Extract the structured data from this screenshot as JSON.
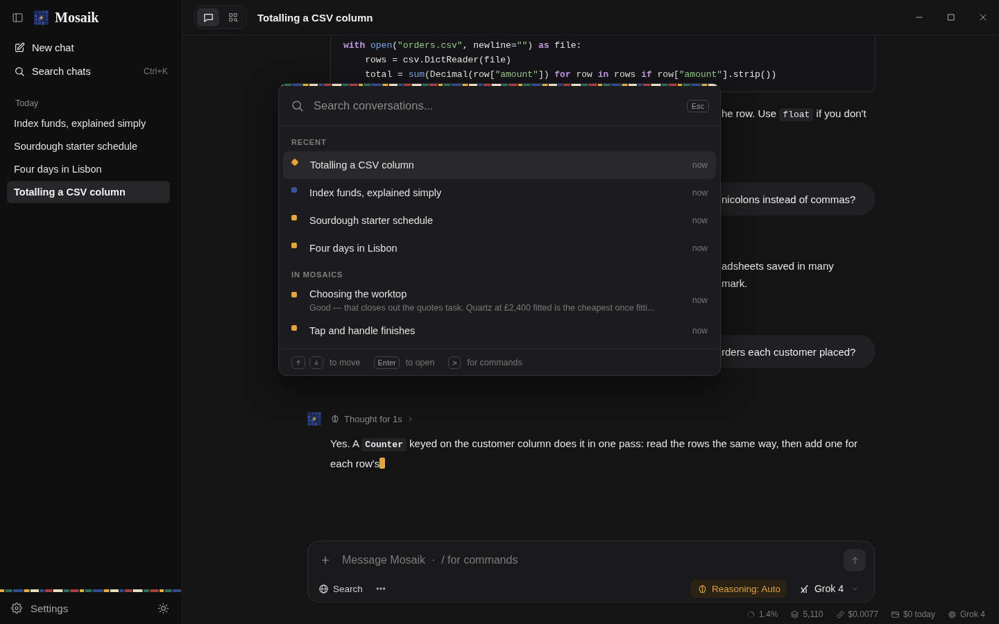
{
  "sidebar": {
    "app_name": "Mosaik",
    "actions": [
      {
        "kind": "new_chat",
        "label": "New chat"
      },
      {
        "kind": "search",
        "label": "Search chats",
        "shortcut": "Ctrl+K"
      }
    ],
    "section": "Today",
    "chats": [
      {
        "label": "Index funds, explained simply",
        "selected": false
      },
      {
        "label": "Sourdough starter schedule",
        "selected": false
      },
      {
        "label": "Four days in Lisbon",
        "selected": false
      },
      {
        "label": "Totalling a CSV column",
        "selected": true
      }
    ],
    "settings": "Settings"
  },
  "topbar": {
    "modes": [
      {
        "kind": "chat",
        "selected": true
      },
      {
        "kind": "mosaic",
        "selected": false
      }
    ],
    "title": "Totalling a CSV column"
  },
  "chat": {
    "code_lines": [
      [
        {
          "kind": "kw",
          "text": "with "
        },
        {
          "kind": "fn",
          "text": "open"
        },
        {
          "kind": "plain",
          "text": "("
        },
        {
          "kind": "str",
          "text": "\"orders.csv\""
        },
        {
          "kind": "plain",
          "text": ", newline="
        },
        {
          "kind": "str",
          "text": "\"\""
        },
        {
          "kind": "plain",
          "text": ") "
        },
        {
          "kind": "kw",
          "text": "as"
        },
        {
          "kind": "plain",
          "text": " file:"
        }
      ],
      [
        {
          "kind": "plain",
          "text": "    rows = csv.DictReader(file)"
        }
      ],
      [
        {
          "kind": "plain",
          "text": "    total = "
        },
        {
          "kind": "fn",
          "text": "sum"
        },
        {
          "kind": "plain",
          "text": "(Decimal(row["
        },
        {
          "kind": "str",
          "text": "\"amount\""
        },
        {
          "kind": "plain",
          "text": "]) "
        },
        {
          "kind": "kw",
          "text": "for"
        },
        {
          "kind": "plain",
          "text": " row "
        },
        {
          "kind": "kw",
          "text": "in"
        },
        {
          "kind": "plain",
          "text": " rows "
        },
        {
          "kind": "kw",
          "text": "if"
        },
        {
          "kind": "plain",
          "text": " row["
        },
        {
          "kind": "str",
          "text": "\"amount\""
        },
        {
          "kind": "plain",
          "text": "].strip())"
        }
      ]
    ],
    "fragments": [
      {
        "kind": "assistant",
        "lines": [
          [
            {
              "kind": "text",
              "text": "he row. Use "
            },
            {
              "kind": "code",
              "text": "float"
            },
            {
              "kind": "text",
              "text": " if you don't"
            }
          ]
        ]
      },
      {
        "kind": "user",
        "lines": [
          [
            {
              "kind": "text",
              "text": "nicolons instead of commas?"
            }
          ]
        ]
      },
      {
        "kind": "assistant",
        "lines": [
          [
            {
              "kind": "text",
              "text": "adsheets saved in many"
            }
          ],
          [
            {
              "kind": "text",
              "text": "mark."
            }
          ]
        ]
      },
      {
        "kind": "user",
        "lines": [
          [
            {
              "kind": "text",
              "text": "rders each customer placed?"
            }
          ]
        ]
      }
    ],
    "reply": {
      "thought": "Thought for 1s",
      "segments": [
        {
          "kind": "text",
          "text": "Yes. A "
        },
        {
          "kind": "code",
          "text": "Counter"
        },
        {
          "kind": "text",
          "text": " keyed on the customer column does it in one pass: read the rows the same way, then add one for each row's"
        }
      ],
      "streaming": true
    }
  },
  "search_modal": {
    "placeholder": "Search conversations...",
    "esc": "Esc",
    "sections": [
      {
        "label": "RECENT",
        "items": [
          {
            "title": "Totalling a CSV column",
            "time": "now",
            "color": "#e5a53c",
            "selected": true
          },
          {
            "title": "Index funds, explained simply",
            "time": "now",
            "color": "#3a5699",
            "selected": false
          },
          {
            "title": "Sourdough starter schedule",
            "time": "now",
            "color": "#e5a53c",
            "selected": false
          },
          {
            "title": "Four days in Lisbon",
            "time": "now",
            "color": "#e5a53c",
            "selected": false
          }
        ]
      },
      {
        "label": "IN MOSAICS",
        "items": [
          {
            "title": "Choosing the worktop",
            "preview": "Good — that closes out the quotes task. Quartz at £2,400 fitted is the cheapest once fitti...",
            "time": "now",
            "color": "#e5a53c",
            "selected": false
          },
          {
            "title": "Tap and handle finishes",
            "time": "now",
            "color": "#e5a53c",
            "selected": false
          }
        ]
      }
    ],
    "hints": [
      {
        "keys": [
          {
            "kind": "up"
          },
          {
            "kind": "down"
          }
        ],
        "text": "to move"
      },
      {
        "keys": [
          {
            "kind": "label",
            "label": "Enter"
          }
        ],
        "text": "to open"
      },
      {
        "keys": [
          {
            "kind": "label",
            "label": ">"
          }
        ],
        "text": "for commands"
      }
    ]
  },
  "composer": {
    "placeholder": "Message Mosaik  ·  / for commands",
    "send_disabled": true,
    "search": "Search",
    "reasoning": "Reasoning: Auto",
    "model": "Grok 4"
  },
  "status_bar": [
    {
      "kind": "context",
      "text": "1.4%"
    },
    {
      "kind": "tokens",
      "text": "5,110"
    },
    {
      "kind": "cost",
      "text": "$0.0077"
    },
    {
      "kind": "daily",
      "text": "$0 today"
    },
    {
      "kind": "model",
      "text": "Grok 4"
    }
  ]
}
